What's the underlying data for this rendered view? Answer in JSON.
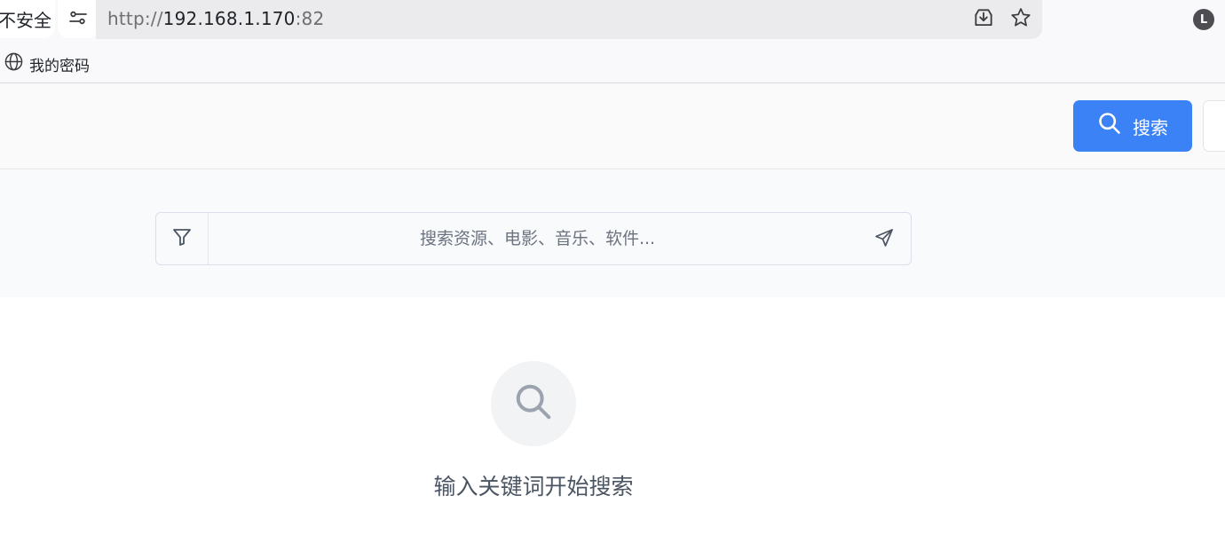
{
  "browser": {
    "security_label": "不安全",
    "url": {
      "scheme": "http://",
      "host": "192.168.1.170",
      "port": ":82"
    },
    "profile_initial": "L",
    "bookmarks": [
      {
        "label": "我的密码",
        "icon": "globe-icon"
      }
    ],
    "icons": {
      "site_settings": "tune-icon",
      "install": "download-icon",
      "bookmark_star": "star-icon"
    }
  },
  "header": {
    "search_button_label": "搜索",
    "search_button_icon": "search-icon"
  },
  "search": {
    "placeholder": "搜索资源、电影、音乐、软件...",
    "value": "",
    "filter_icon": "filter-icon",
    "send_icon": "send-icon"
  },
  "empty_state": {
    "icon": "search-icon",
    "message": "输入关键词开始搜索"
  },
  "colors": {
    "primary": "#3b82f6",
    "chrome_bg": "#f9f9fb",
    "url_bar_bg": "#ebebee",
    "muted_text": "#4b5563"
  }
}
